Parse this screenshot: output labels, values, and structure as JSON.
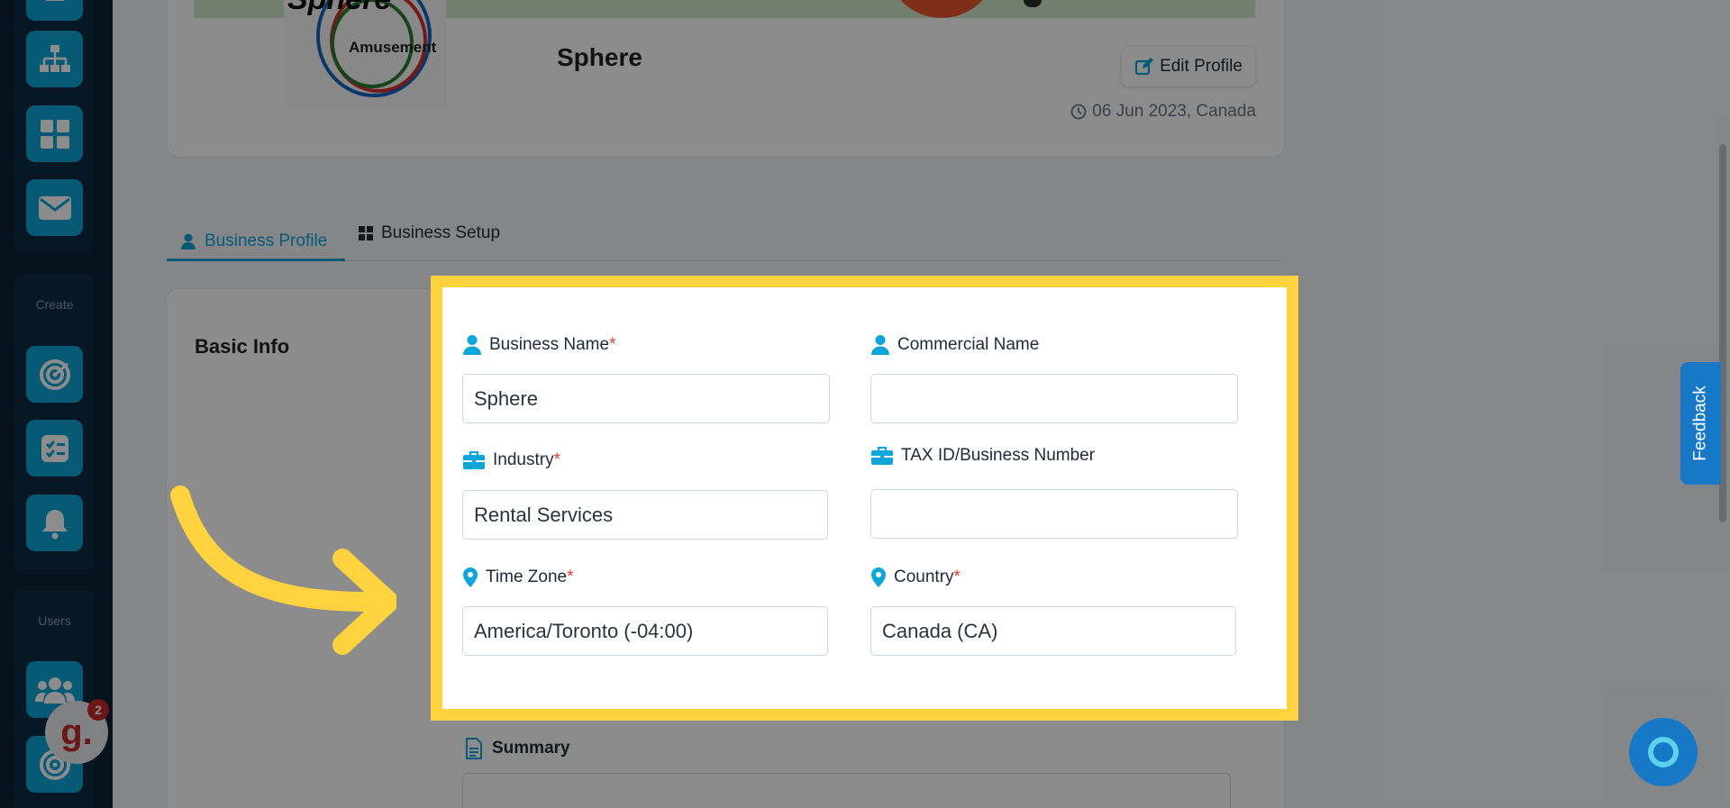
{
  "sidebar": {
    "section_create": "Create",
    "section_users": "Users"
  },
  "profile": {
    "company_name": "Sphere",
    "logo_text": "Sphere",
    "logo_subtext": "Amusement",
    "edit_label": "Edit Profile",
    "date_text": "06 Jun 2023, Canada"
  },
  "tabs": [
    {
      "label": "Business Profile",
      "active": true
    },
    {
      "label": "Business Setup",
      "active": false
    }
  ],
  "section_title": "Basic Info",
  "form": {
    "business_name": {
      "label": "Business Name",
      "required": "*",
      "value": "Sphere"
    },
    "commercial_name": {
      "label": "Commercial Name",
      "value": ""
    },
    "industry": {
      "label": "Industry",
      "required": "*",
      "value": "Rental Services"
    },
    "tax_id": {
      "label": "TAX ID/Business Number",
      "value": ""
    },
    "time_zone": {
      "label": "Time Zone",
      "required": "*",
      "value": "America/Toronto (-04:00)"
    },
    "country": {
      "label": "Country",
      "required": "*",
      "value": "Canada (CA)"
    }
  },
  "summary_label": "Summary",
  "feedback_label": "Feedback",
  "notification_badge": {
    "letter": "g.",
    "count": "2"
  },
  "colors": {
    "accent": "#0ea5d8",
    "highlight": "#ffd23f",
    "required": "#e53935"
  }
}
